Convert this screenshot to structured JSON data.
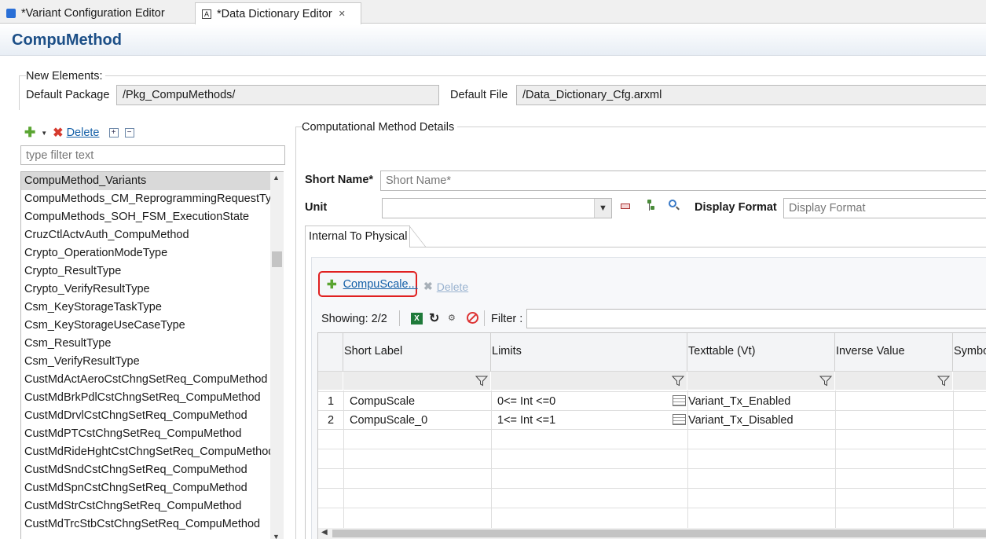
{
  "tabs": [
    {
      "label": "*Variant Configuration Editor"
    },
    {
      "label": "*Data Dictionary Editor"
    }
  ],
  "page": {
    "title": "CompuMethod"
  },
  "new_elements": {
    "group_label": "New Elements:",
    "default_package_label": "Default Package",
    "default_package_value": "/Pkg_CompuMethods/",
    "default_file_label": "Default File",
    "default_file_value": "/Data_Dictionary_Cfg.arxml"
  },
  "left_toolbar": {
    "delete_label": "Delete",
    "filter_placeholder": "type filter text"
  },
  "compu_methods": [
    {
      "label": "CompuMethod_Variants",
      "selected": true
    },
    {
      "label": "CompuMethods_CM_ReprogrammingRequestTy"
    },
    {
      "label": "CompuMethods_SOH_FSM_ExecutionState"
    },
    {
      "label": "CruzCtlActvAuth_CompuMethod"
    },
    {
      "label": "Crypto_OperationModeType"
    },
    {
      "label": "Crypto_ResultType"
    },
    {
      "label": "Crypto_VerifyResultType"
    },
    {
      "label": "Csm_KeyStorageTaskType"
    },
    {
      "label": "Csm_KeyStorageUseCaseType"
    },
    {
      "label": "Csm_ResultType"
    },
    {
      "label": "Csm_VerifyResultType"
    },
    {
      "label": "CustMdActAeroCstChngSetReq_CompuMethod"
    },
    {
      "label": "CustMdBrkPdlCstChngSetReq_CompuMethod"
    },
    {
      "label": "CustMdDrvlCstChngSetReq_CompuMethod"
    },
    {
      "label": "CustMdPTCstChngSetReq_CompuMethod"
    },
    {
      "label": "CustMdRideHghtCstChngSetReq_CompuMethod"
    },
    {
      "label": "CustMdSndCstChngSetReq_CompuMethod"
    },
    {
      "label": "CustMdSpnCstChngSetReq_CompuMethod"
    },
    {
      "label": "CustMdStrCstChngSetReq_CompuMethod"
    },
    {
      "label": "CustMdTrcStbCstChngSetReq_CompuMethod"
    }
  ],
  "details": {
    "group_label": "Computational Method Details",
    "short_name_label": "Short Name*",
    "short_name_placeholder": "Short Name*",
    "unit_label": "Unit",
    "unit_value": "",
    "display_format_label": "Display Format",
    "display_format_placeholder": "Display Format",
    "inner_tab_label": "Internal To Physical"
  },
  "scale_toolbar": {
    "compuscale_label": "CompuScale...",
    "delete_label": "Delete",
    "showing": "Showing: 2/2",
    "filter_label": "Filter :"
  },
  "table": {
    "columns": [
      "Short Label",
      "Limits",
      "Texttable (Vt)",
      "Inverse Value",
      "Symbo"
    ],
    "rows": [
      {
        "num": "1",
        "short_label": "CompuScale",
        "limits": "0<= Int <=0",
        "texttable": "Variant_Tx_Enabled"
      },
      {
        "num": "2",
        "short_label": "CompuScale_0",
        "limits": "1<= Int <=1",
        "texttable": "Variant_Tx_Disabled"
      }
    ]
  },
  "colors": {
    "title": "#1c4f87",
    "link": "#1560a8",
    "highlight_border": "#e02020",
    "add_icon": "#5aa532",
    "delete_icon": "#d63b2f"
  },
  "icons": [
    "variant-editor-icon",
    "data-dictionary-icon",
    "close-icon",
    "add-icon",
    "chevron-down-icon",
    "delete-icon",
    "expand-all-icon",
    "collapse-all-icon",
    "new-unit-icon",
    "tree-icon",
    "find-icon",
    "excel-export-icon",
    "refresh-icon",
    "clear-filter-icon",
    "disable-filter-icon",
    "column-filter-icon",
    "texttable-icon"
  ]
}
